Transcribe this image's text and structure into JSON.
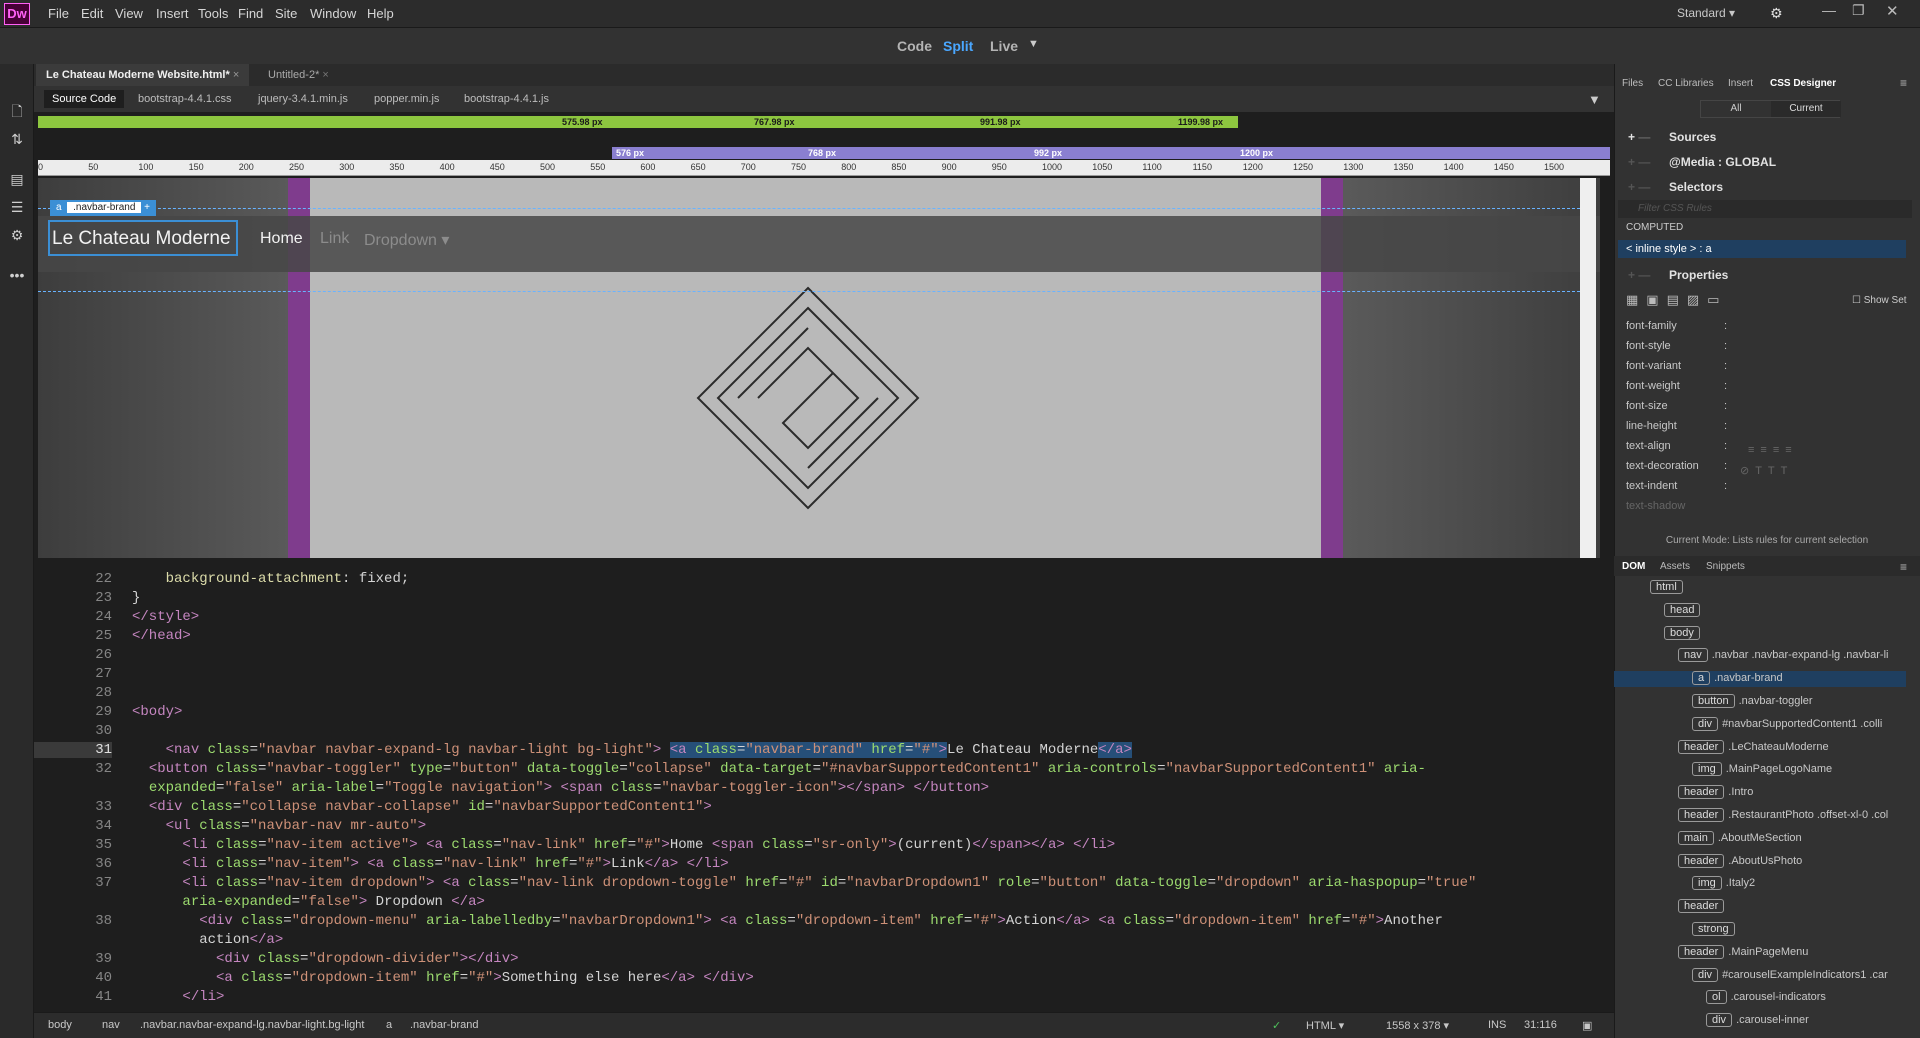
{
  "app": {
    "logo": "Dw",
    "workspace": "Standard"
  },
  "menu": [
    "File",
    "Edit",
    "View",
    "Insert",
    "Tools",
    "Find",
    "Site",
    "Window",
    "Help"
  ],
  "view_modes": [
    "Code",
    "Split",
    "Live"
  ],
  "doc_tabs": [
    "Le Chateau Moderne Website.html*",
    "Untitled-2*"
  ],
  "related_files": [
    "Source Code",
    "bootstrap-4.4.1.css",
    "jquery-3.4.1.min.js",
    "popper.min.js",
    "bootstrap-4.4.1.js"
  ],
  "media_queries_green": [
    "575.98 px",
    "767.98 px",
    "991.98 px",
    "1199.98 px"
  ],
  "media_queries_purple": [
    "576 px",
    "768 px",
    "992 px",
    "1200 px"
  ],
  "ruler": [
    "0",
    "50",
    "100",
    "150",
    "200",
    "250",
    "300",
    "350",
    "400",
    "450",
    "500",
    "550",
    "600",
    "650",
    "700",
    "750",
    "800",
    "850",
    "900",
    "950",
    "1000",
    "1050",
    "1100",
    "1150",
    "1200",
    "1250",
    "1300",
    "1350",
    "1400",
    "1450",
    "1500"
  ],
  "live": {
    "brand_tag": ".navbar-brand",
    "brand_text": "Le Chateau Moderne",
    "nav": [
      "Home",
      "Link",
      "Dropdown"
    ]
  },
  "code": [
    {
      "n": "22",
      "html": "    <span class='k'>background-attachment</span>: fixed;"
    },
    {
      "n": "23",
      "html": "}"
    },
    {
      "n": "24",
      "html": "<span class='t'>&lt;/style&gt;</span>"
    },
    {
      "n": "25",
      "html": "<span class='t'>&lt;/head&gt;</span>"
    },
    {
      "n": "26",
      "html": ""
    },
    {
      "n": "27",
      "html": ""
    },
    {
      "n": "28",
      "html": ""
    },
    {
      "n": "29",
      "html": "<span class='t'>&lt;body&gt;</span>"
    },
    {
      "n": "30",
      "html": ""
    },
    {
      "n": "31",
      "html": "    <span class='t'>&lt;nav</span> <span class='a'>class</span>=<span class='s'>\"navbar navbar-expand-lg navbar-light bg-light\"</span><span class='t'>&gt;</span> <span class='hl'><span class='t'>&lt;a</span> <span class='a'>class</span>=<span class='s'>\"navbar-brand\"</span> <span class='a'>href</span>=<span class='s'>\"#\"</span><span class='t'>&gt;</span></span>Le Chateau Moderne<span class='hl'><span class='t'>&lt;/a&gt;</span></span>"
    },
    {
      "n": "32",
      "html": "  <span class='t'>&lt;button</span> <span class='a'>class</span>=<span class='s'>\"navbar-toggler\"</span> <span class='a'>type</span>=<span class='s'>\"button\"</span> <span class='a'>data-toggle</span>=<span class='s'>\"collapse\"</span> <span class='a'>data-target</span>=<span class='s'>\"#navbarSupportedContent1\"</span> <span class='a'>aria-controls</span>=<span class='s'>\"navbarSupportedContent1\"</span> <span class='a'>aria-</span>"
    },
    {
      "n": "",
      "html": "  <span class='a'>expanded</span>=<span class='s'>\"false\"</span> <span class='a'>aria-label</span>=<span class='s'>\"Toggle navigation\"</span><span class='t'>&gt;</span> <span class='t'>&lt;span</span> <span class='a'>class</span>=<span class='s'>\"navbar-toggler-icon\"</span><span class='t'>&gt;&lt;/span&gt;</span> <span class='t'>&lt;/button&gt;</span>"
    },
    {
      "n": "33",
      "html": "  <span class='t'>&lt;div</span> <span class='a'>class</span>=<span class='s'>\"collapse navbar-collapse\"</span> <span class='a'>id</span>=<span class='s'>\"navbarSupportedContent1\"</span><span class='t'>&gt;</span>"
    },
    {
      "n": "34",
      "html": "    <span class='t'>&lt;ul</span> <span class='a'>class</span>=<span class='s'>\"navbar-nav mr-auto\"</span><span class='t'>&gt;</span>"
    },
    {
      "n": "35",
      "html": "      <span class='t'>&lt;li</span> <span class='a'>class</span>=<span class='s'>\"nav-item active\"</span><span class='t'>&gt;</span> <span class='t'>&lt;a</span> <span class='a'>class</span>=<span class='s'>\"nav-link\"</span> <span class='a'>href</span>=<span class='s'>\"#\"</span><span class='t'>&gt;</span>Home <span class='t'>&lt;span</span> <span class='a'>class</span>=<span class='s'>\"sr-only\"</span><span class='t'>&gt;</span>(current)<span class='t'>&lt;/span&gt;&lt;/a&gt;</span> <span class='t'>&lt;/li&gt;</span>"
    },
    {
      "n": "36",
      "html": "      <span class='t'>&lt;li</span> <span class='a'>class</span>=<span class='s'>\"nav-item\"</span><span class='t'>&gt;</span> <span class='t'>&lt;a</span> <span class='a'>class</span>=<span class='s'>\"nav-link\"</span> <span class='a'>href</span>=<span class='s'>\"#\"</span><span class='t'>&gt;</span>Link<span class='t'>&lt;/a&gt;</span> <span class='t'>&lt;/li&gt;</span>"
    },
    {
      "n": "37",
      "html": "      <span class='t'>&lt;li</span> <span class='a'>class</span>=<span class='s'>\"nav-item dropdown\"</span><span class='t'>&gt;</span> <span class='t'>&lt;a</span> <span class='a'>class</span>=<span class='s'>\"nav-link dropdown-toggle\"</span> <span class='a'>href</span>=<span class='s'>\"#\"</span> <span class='a'>id</span>=<span class='s'>\"navbarDropdown1\"</span> <span class='a'>role</span>=<span class='s'>\"button\"</span> <span class='a'>data-toggle</span>=<span class='s'>\"dropdown\"</span> <span class='a'>aria-haspopup</span>=<span class='s'>\"true\"</span>"
    },
    {
      "n": "",
      "html": "      <span class='a'>aria-expanded</span>=<span class='s'>\"false\"</span><span class='t'>&gt;</span> Dropdown <span class='t'>&lt;/a&gt;</span>"
    },
    {
      "n": "38",
      "html": "        <span class='t'>&lt;div</span> <span class='a'>class</span>=<span class='s'>\"dropdown-menu\"</span> <span class='a'>aria-labelledby</span>=<span class='s'>\"navbarDropdown1\"</span><span class='t'>&gt;</span> <span class='t'>&lt;a</span> <span class='a'>class</span>=<span class='s'>\"dropdown-item\"</span> <span class='a'>href</span>=<span class='s'>\"#\"</span><span class='t'>&gt;</span>Action<span class='t'>&lt;/a&gt;</span> <span class='t'>&lt;a</span> <span class='a'>class</span>=<span class='s'>\"dropdown-item\"</span> <span class='a'>href</span>=<span class='s'>\"#\"</span><span class='t'>&gt;</span>Another"
    },
    {
      "n": "",
      "html": "        action<span class='t'>&lt;/a&gt;</span>"
    },
    {
      "n": "39",
      "html": "          <span class='t'>&lt;div</span> <span class='a'>class</span>=<span class='s'>\"dropdown-divider\"</span><span class='t'>&gt;&lt;/div&gt;</span>"
    },
    {
      "n": "40",
      "html": "          <span class='t'>&lt;a</span> <span class='a'>class</span>=<span class='s'>\"dropdown-item\"</span> <span class='a'>href</span>=<span class='s'>\"#\"</span><span class='t'>&gt;</span>Something else here<span class='t'>&lt;/a&gt;</span> <span class='t'>&lt;/div&gt;</span>"
    },
    {
      "n": "41",
      "html": "      <span class='t'>&lt;/li&gt;</span>"
    }
  ],
  "status": {
    "crumbs": [
      "body",
      "nav",
      ".navbar.navbar-expand-lg.navbar-light.bg-light",
      "a",
      ".navbar-brand"
    ],
    "lang": "HTML",
    "size": "1558 x 378",
    "mode": "INS",
    "pos": "31:116"
  },
  "panel_tabs": [
    "Files",
    "CC Libraries",
    "Insert",
    "CSS Designer"
  ],
  "css": {
    "all": "All",
    "current": "Current",
    "sources": "Sources",
    "media": "@Media : GLOBAL",
    "selectors": "Selectors",
    "filter": "Filter CSS Rules",
    "computed": "COMPUTED",
    "inline": "< inline style > : a",
    "properties": "Properties",
    "show_set": "Show Set",
    "props": [
      "font-family",
      "font-style",
      "font-variant",
      "font-weight",
      "font-size",
      "line-height",
      "text-align",
      "text-decoration",
      "text-indent",
      "text-shadow"
    ],
    "mode": "Current Mode: Lists rules for current selection"
  },
  "dom_tabs": [
    "DOM",
    "Assets",
    "Snippets"
  ],
  "dom": [
    {
      "d": 0,
      "tag": "html",
      "sel": ""
    },
    {
      "d": 1,
      "tag": "head",
      "sel": ""
    },
    {
      "d": 1,
      "tag": "body",
      "sel": ""
    },
    {
      "d": 2,
      "tag": "nav",
      "sel": ".navbar .navbar-expand-lg .navbar-li"
    },
    {
      "d": 3,
      "tag": "a",
      "sel": ".navbar-brand",
      "active": true
    },
    {
      "d": 3,
      "tag": "button",
      "sel": ".navbar-toggler"
    },
    {
      "d": 3,
      "tag": "div",
      "sel": "#navbarSupportedContent1 .colli"
    },
    {
      "d": 2,
      "tag": "header",
      "sel": ".LeChateauModerne"
    },
    {
      "d": 3,
      "tag": "img",
      "sel": ".MainPageLogoName"
    },
    {
      "d": 2,
      "tag": "header",
      "sel": ".Intro"
    },
    {
      "d": 2,
      "tag": "header",
      "sel": ".RestaurantPhoto .offset-xl-0 .col"
    },
    {
      "d": 2,
      "tag": "main",
      "sel": ".AboutMeSection"
    },
    {
      "d": 2,
      "tag": "header",
      "sel": ".AboutUsPhoto"
    },
    {
      "d": 3,
      "tag": "img",
      "sel": ".Italy2"
    },
    {
      "d": 2,
      "tag": "header",
      "sel": ""
    },
    {
      "d": 3,
      "tag": "strong",
      "sel": ""
    },
    {
      "d": 2,
      "tag": "header",
      "sel": ".MainPageMenu"
    },
    {
      "d": 3,
      "tag": "div",
      "sel": "#carouselExampleIndicators1 .car"
    },
    {
      "d": 4,
      "tag": "ol",
      "sel": ".carousel-indicators"
    },
    {
      "d": 4,
      "tag": "div",
      "sel": ".carousel-inner"
    }
  ]
}
